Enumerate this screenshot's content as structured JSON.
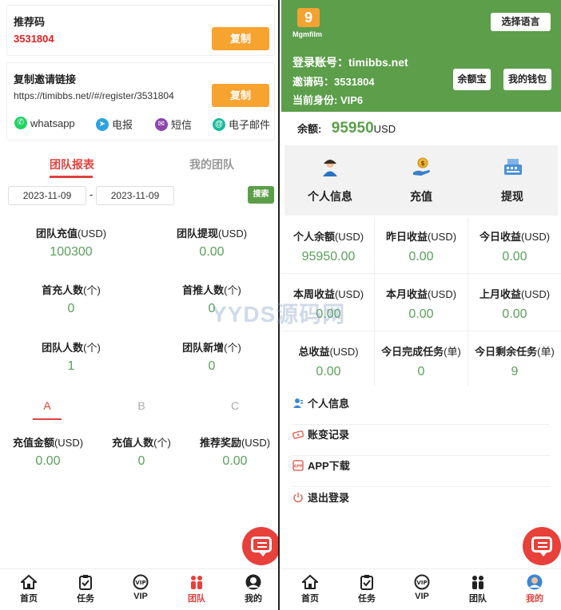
{
  "left": {
    "referral": {
      "label": "推荐码",
      "code": "3531804",
      "copy_label": "复制"
    },
    "invite": {
      "label": "复制邀请链接",
      "link": "https://timibbs.net//#/register/3531804",
      "copy_label": "复制"
    },
    "share": [
      {
        "label": "whatsapp",
        "icon": "whatsapp-icon",
        "color": "#25d366"
      },
      {
        "label": "电报",
        "icon": "telegram-icon",
        "color": "#2aa3e0"
      },
      {
        "label": "短信",
        "icon": "sms-icon",
        "color": "#8e44ad"
      },
      {
        "label": "电子邮件",
        "icon": "email-icon",
        "color": "#1abc9c"
      }
    ],
    "tabs": [
      {
        "label": "团队报表"
      },
      {
        "label": "我的团队"
      }
    ],
    "date_from": "2023-11-09",
    "date_sep": "-",
    "date_to": "2023-11-09",
    "search_label": "搜索",
    "stats": [
      {
        "title": "团队充值",
        "unit": "(USD)",
        "value": "100300"
      },
      {
        "title": "团队提现",
        "unit": "(USD)",
        "value": "0.00"
      },
      {
        "title": "首充人数",
        "unit": "(个)",
        "value": "0"
      },
      {
        "title": "首推人数",
        "unit": "(个)",
        "value": "0"
      },
      {
        "title": "团队人数",
        "unit": "(个)",
        "value": "1"
      },
      {
        "title": "团队新增",
        "unit": "(个)",
        "value": "0"
      }
    ],
    "level_tabs": [
      {
        "label": "A"
      },
      {
        "label": "B"
      },
      {
        "label": "C"
      }
    ],
    "level_stats": [
      {
        "title": "充值金额",
        "unit": "(USD)",
        "value": "0.00"
      },
      {
        "title": "充值人数",
        "unit": "(个)",
        "value": "0"
      },
      {
        "title": "推荐奖励",
        "unit": "(USD)",
        "value": "0.00"
      }
    ]
  },
  "nav": [
    {
      "label": "首页",
      "icon": "home-icon"
    },
    {
      "label": "任务",
      "icon": "task-icon"
    },
    {
      "label": "VIP",
      "icon": "vip-icon"
    },
    {
      "label": "团队",
      "icon": "team-icon"
    },
    {
      "label": "我的",
      "icon": "profile-icon"
    }
  ],
  "right": {
    "logo_text": "Mgmfilm",
    "lang_button": "选择语言",
    "account_label": "登录账号：",
    "account_value": "timibbs.net",
    "invite_label": "邀请码：",
    "invite_value": "3531804",
    "identity_label": "当前身份: ",
    "identity_value": "VIP6",
    "yuebao_label": "余额宝",
    "wallet_label": "我的钱包",
    "balance_label": "余额:",
    "balance_value": "95950",
    "balance_unit": "USD",
    "quick": [
      {
        "label": "个人信息",
        "icon": "person-icon"
      },
      {
        "label": "充值",
        "icon": "coin-hand-icon"
      },
      {
        "label": "提现",
        "icon": "cash-register-icon"
      }
    ],
    "stats": [
      {
        "title": "个人余额",
        "unit": "(USD)",
        "value": "95950.00"
      },
      {
        "title": "昨日收益",
        "unit": "(USD)",
        "value": "0.00"
      },
      {
        "title": "今日收益",
        "unit": "(USD)",
        "value": "0.00"
      },
      {
        "title": "本周收益",
        "unit": "(USD)",
        "value": "0.00"
      },
      {
        "title": "本月收益",
        "unit": "(USD)",
        "value": "0.00"
      },
      {
        "title": "上月收益",
        "unit": "(USD)",
        "value": "0.00"
      },
      {
        "title": "总收益",
        "unit": "(USD)",
        "value": "0.00"
      },
      {
        "title": "今日完成任务",
        "unit": "(单)",
        "value": "0"
      },
      {
        "title": "今日剩余任务",
        "unit": "(单)",
        "value": "9"
      }
    ],
    "menu": [
      {
        "label": "个人信息",
        "icon": "user-icon"
      },
      {
        "label": "账变记录",
        "icon": "ticket-icon"
      },
      {
        "label": "APP下载",
        "icon": "app-icon"
      },
      {
        "label": "退出登录",
        "icon": "power-icon"
      }
    ]
  },
  "watermark": "YYDS源码网",
  "colors": {
    "accent_green": "#5c9e4a",
    "orange": "#f7a330",
    "red": "#e8403a"
  }
}
